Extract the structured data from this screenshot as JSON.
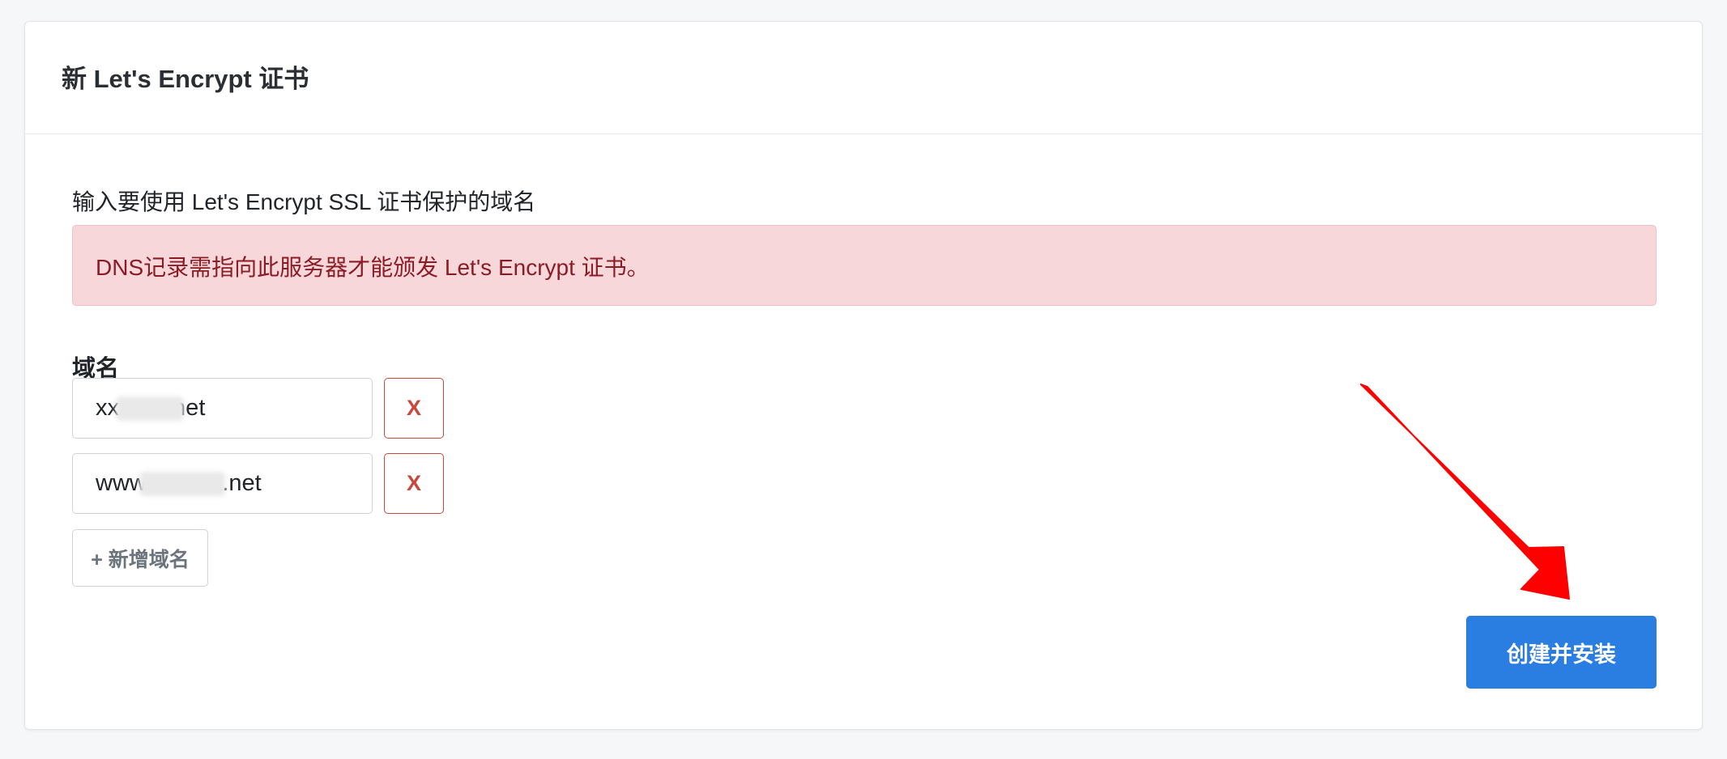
{
  "card": {
    "title": "新 Let's Encrypt 证书",
    "intro": "输入要使用 Let's Encrypt SSL 证书保护的域名",
    "alert": "DNS记录需指向此服务器才能颁发 Let's Encrypt 证书。"
  },
  "domains": {
    "label": "域名",
    "entries": [
      {
        "value": "xxxxxx.net"
      },
      {
        "value": "www.xxxxxx.net"
      }
    ],
    "remove_label": "X",
    "add_label": "+ 新增域名"
  },
  "actions": {
    "submit_label": "创建并安装"
  },
  "colors": {
    "primary": "#2a7de1",
    "danger": "#c9473c",
    "alert_bg": "#f8d7da",
    "alert_text": "#8b1c25",
    "annotation": "#ff0000"
  },
  "annotation": {
    "icon": "red-arrow-icon"
  }
}
